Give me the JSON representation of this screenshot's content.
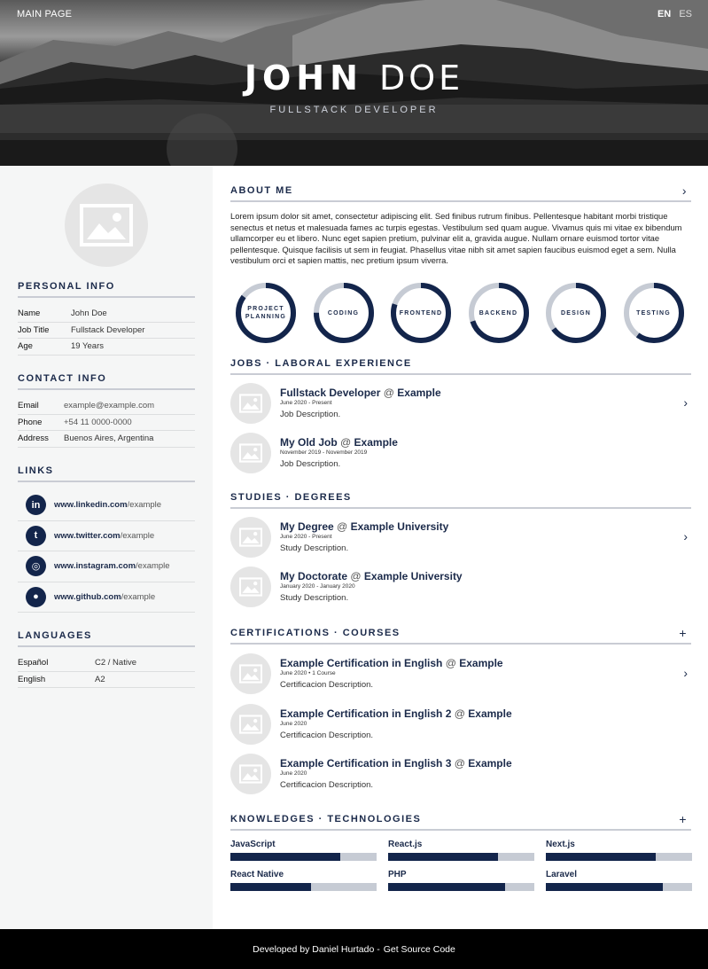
{
  "nav": {
    "main_page": "MAIN PAGE",
    "lang_en": "EN",
    "lang_es": "ES"
  },
  "hero": {
    "first_name": "JOHN",
    "last_name": "DOE",
    "role": "FULLSTACK DEVELOPER"
  },
  "sidebar": {
    "personal_title": "PERSONAL INFO",
    "personal": [
      {
        "k": "Name",
        "v": "John Doe"
      },
      {
        "k": "Job Title",
        "v": "Fullstack Developer"
      },
      {
        "k": "Age",
        "v": "19 Years"
      }
    ],
    "contact_title": "CONTACT INFO",
    "contact": [
      {
        "k": "Email",
        "v": "example@example.com"
      },
      {
        "k": "Phone",
        "v": "+54 11 0000-0000"
      },
      {
        "k": "Address",
        "v": "Buenos Aires, Argentina"
      }
    ],
    "links_title": "LINKS",
    "links": [
      {
        "icon": "linkedin-icon",
        "glyph": "in",
        "host": "www.linkedin.com",
        "path": "/example"
      },
      {
        "icon": "twitter-icon",
        "glyph": "t",
        "host": "www.twitter.com",
        "path": "/example"
      },
      {
        "icon": "instagram-icon",
        "glyph": "◎",
        "host": "www.instagram.com",
        "path": "/example"
      },
      {
        "icon": "github-icon",
        "glyph": "●",
        "host": "www.github.com",
        "path": "/example"
      }
    ],
    "languages_title": "LANGUAGES",
    "languages": [
      {
        "k": "Español",
        "v": "C2 / Native"
      },
      {
        "k": "English",
        "v": "A2"
      }
    ]
  },
  "about": {
    "title": "ABOUT ME",
    "text": "Lorem ipsum dolor sit amet, consectetur adipiscing elit. Sed finibus rutrum finibus. Pellentesque habitant morbi tristique senectus et netus et malesuada fames ac turpis egestas. Vestibulum sed quam augue. Vivamus quis mi vitae ex bibendum ullamcorper eu et libero. Nunc eget sapien pretium, pulvinar elit a, gravida augue. Nullam ornare euismod tortor vitae pellentesque. Quisque facilisis ut sem in feugiat. Phasellus vitae nibh sit amet sapien faucibus euismod eget a sem. Nulla vestibulum orci et sapien mattis, nec pretium ipsum viverra."
  },
  "rings": [
    {
      "label_1": "PROJECT",
      "label_2": "PLANNING",
      "level": 0.85
    },
    {
      "label_1": "CODING",
      "label_2": "",
      "level": 0.75
    },
    {
      "label_1": "FRONTEND",
      "label_2": "",
      "level": 0.8
    },
    {
      "label_1": "BACKEND",
      "label_2": "",
      "level": 0.7
    },
    {
      "label_1": "DESIGN",
      "label_2": "",
      "level": 0.65
    },
    {
      "label_1": "TESTING",
      "label_2": "",
      "level": 0.6
    }
  ],
  "jobs": {
    "title": "JOBS · LABORAL EXPERIENCE",
    "items": [
      {
        "title": "Fullstack Developer",
        "at": "@",
        "org": "Example",
        "date": "June 2020 - Present",
        "desc": "Job Description."
      },
      {
        "title": "My Old Job",
        "at": "@",
        "org": "Example",
        "date": "November 2019 - November 2019",
        "desc": "Job Description."
      }
    ]
  },
  "studies": {
    "title": "STUDIES · DEGREES",
    "items": [
      {
        "title": "My Degree",
        "at": "@",
        "org": "Example University",
        "date": "June 2020 - Present",
        "desc": "Study Description."
      },
      {
        "title": "My Doctorate",
        "at": "@",
        "org": "Example University",
        "date": "January 2020 - January 2020",
        "desc": "Study Description."
      }
    ]
  },
  "certs": {
    "title": "CERTIFICATIONS · COURSES",
    "items": [
      {
        "title": "Example Certification in English",
        "at": "@",
        "org": "Example",
        "date": "June 2020 • 1 Course",
        "desc": "Certificacion Description."
      },
      {
        "title": "Example Certification in English 2",
        "at": "@",
        "org": "Example",
        "date": "June 2020",
        "desc": "Certificacion Description."
      },
      {
        "title": "Example Certification in English 3",
        "at": "@",
        "org": "Example",
        "date": "June 2020",
        "desc": "Certificacion Description."
      }
    ]
  },
  "knowledge": {
    "title": "KNOWLEDGES · TECHNOLOGIES",
    "skills": [
      {
        "name": "JavaScript",
        "level": 0.75
      },
      {
        "name": "React.js",
        "level": 0.75
      },
      {
        "name": "Next.js",
        "level": 0.75
      },
      {
        "name": "React Native",
        "level": 0.55
      },
      {
        "name": "PHP",
        "level": 0.8
      },
      {
        "name": "Laravel",
        "level": 0.8
      }
    ]
  },
  "footer": {
    "credit": "Developed by Daniel Hurtado -",
    "source": "Get Source Code"
  },
  "colors": {
    "navy": "#13254b",
    "track": "#c6cbd4",
    "sidebar": "#f5f6f6"
  }
}
